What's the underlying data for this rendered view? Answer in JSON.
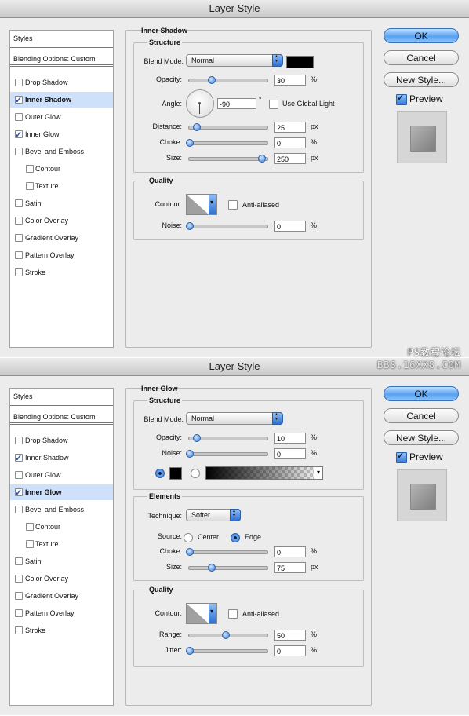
{
  "dialog1": {
    "title": "Layer Style",
    "styles_header": "Styles",
    "blending_options": "Blending Options: Custom",
    "items": [
      {
        "label": "Drop Shadow",
        "checked": false,
        "indent": false
      },
      {
        "label": "Inner Shadow",
        "checked": true,
        "indent": false,
        "active": true
      },
      {
        "label": "Outer Glow",
        "checked": false,
        "indent": false
      },
      {
        "label": "Inner Glow",
        "checked": true,
        "indent": false
      },
      {
        "label": "Bevel and Emboss",
        "checked": false,
        "indent": false
      },
      {
        "label": "Contour",
        "checked": false,
        "indent": true
      },
      {
        "label": "Texture",
        "checked": false,
        "indent": true
      },
      {
        "label": "Satin",
        "checked": false,
        "indent": false
      },
      {
        "label": "Color Overlay",
        "checked": false,
        "indent": false
      },
      {
        "label": "Gradient Overlay",
        "checked": false,
        "indent": false
      },
      {
        "label": "Pattern Overlay",
        "checked": false,
        "indent": false
      },
      {
        "label": "Stroke",
        "checked": false,
        "indent": false
      }
    ],
    "panel_title": "Inner Shadow",
    "structure": {
      "title": "Structure",
      "blend_mode_label": "Blend Mode:",
      "blend_mode_value": "Normal",
      "opacity_label": "Opacity:",
      "opacity_value": "30",
      "opacity_unit": "%",
      "opacity_level": 30,
      "angle_label": "Angle:",
      "angle_value": "-90",
      "angle_unit": "°",
      "use_global_light": "Use Global Light",
      "distance_label": "Distance:",
      "distance_value": "25",
      "distance_unit": "px",
      "distance_level": 10,
      "choke_label": "Choke:",
      "choke_value": "0",
      "choke_unit": "%",
      "choke_level": 0,
      "size_label": "Size:",
      "size_value": "250",
      "size_unit": "px",
      "size_level": 100
    },
    "quality": {
      "title": "Quality",
      "contour_label": "Contour:",
      "anti_aliased": "Anti-aliased",
      "noise_label": "Noise:",
      "noise_value": "0",
      "noise_unit": "%",
      "noise_level": 0
    },
    "buttons": {
      "ok": "OK",
      "cancel": "Cancel",
      "new_style": "New Style...",
      "preview": "Preview"
    }
  },
  "dialog2": {
    "title": "Layer Style",
    "styles_header": "Styles",
    "blending_options": "Blending Options: Custom",
    "items": [
      {
        "label": "Drop Shadow",
        "checked": false,
        "indent": false
      },
      {
        "label": "Inner Shadow",
        "checked": true,
        "indent": false
      },
      {
        "label": "Outer Glow",
        "checked": false,
        "indent": false
      },
      {
        "label": "Inner Glow",
        "checked": true,
        "indent": false,
        "active": true
      },
      {
        "label": "Bevel and Emboss",
        "checked": false,
        "indent": false
      },
      {
        "label": "Contour",
        "checked": false,
        "indent": true
      },
      {
        "label": "Texture",
        "checked": false,
        "indent": true
      },
      {
        "label": "Satin",
        "checked": false,
        "indent": false
      },
      {
        "label": "Color Overlay",
        "checked": false,
        "indent": false
      },
      {
        "label": "Gradient Overlay",
        "checked": false,
        "indent": false
      },
      {
        "label": "Pattern Overlay",
        "checked": false,
        "indent": false
      },
      {
        "label": "Stroke",
        "checked": false,
        "indent": false
      }
    ],
    "panel_title": "Inner Glow",
    "structure": {
      "title": "Structure",
      "blend_mode_label": "Blend Mode:",
      "blend_mode_value": "Normal",
      "opacity_label": "Opacity:",
      "opacity_value": "10",
      "opacity_unit": "%",
      "opacity_level": 10,
      "noise_label": "Noise:",
      "noise_value": "0",
      "noise_unit": "%",
      "noise_level": 0
    },
    "elements": {
      "title": "Elements",
      "technique_label": "Technique:",
      "technique_value": "Softer",
      "source_label": "Source:",
      "source_center": "Center",
      "source_edge": "Edge",
      "choke_label": "Choke:",
      "choke_value": "0",
      "choke_unit": "%",
      "choke_level": 0,
      "size_label": "Size:",
      "size_value": "75",
      "size_unit": "px",
      "size_level": 30
    },
    "quality": {
      "title": "Quality",
      "contour_label": "Contour:",
      "anti_aliased": "Anti-aliased",
      "range_label": "Range:",
      "range_value": "50",
      "range_unit": "%",
      "range_level": 50,
      "jitter_label": "Jitter:",
      "jitter_value": "0",
      "jitter_unit": "%",
      "jitter_level": 0
    },
    "buttons": {
      "ok": "OK",
      "cancel": "Cancel",
      "new_style": "New Style...",
      "preview": "Preview"
    }
  },
  "watermark": {
    "line1": "PS教程论坛",
    "line2": "BBS.16XX8.COM"
  }
}
